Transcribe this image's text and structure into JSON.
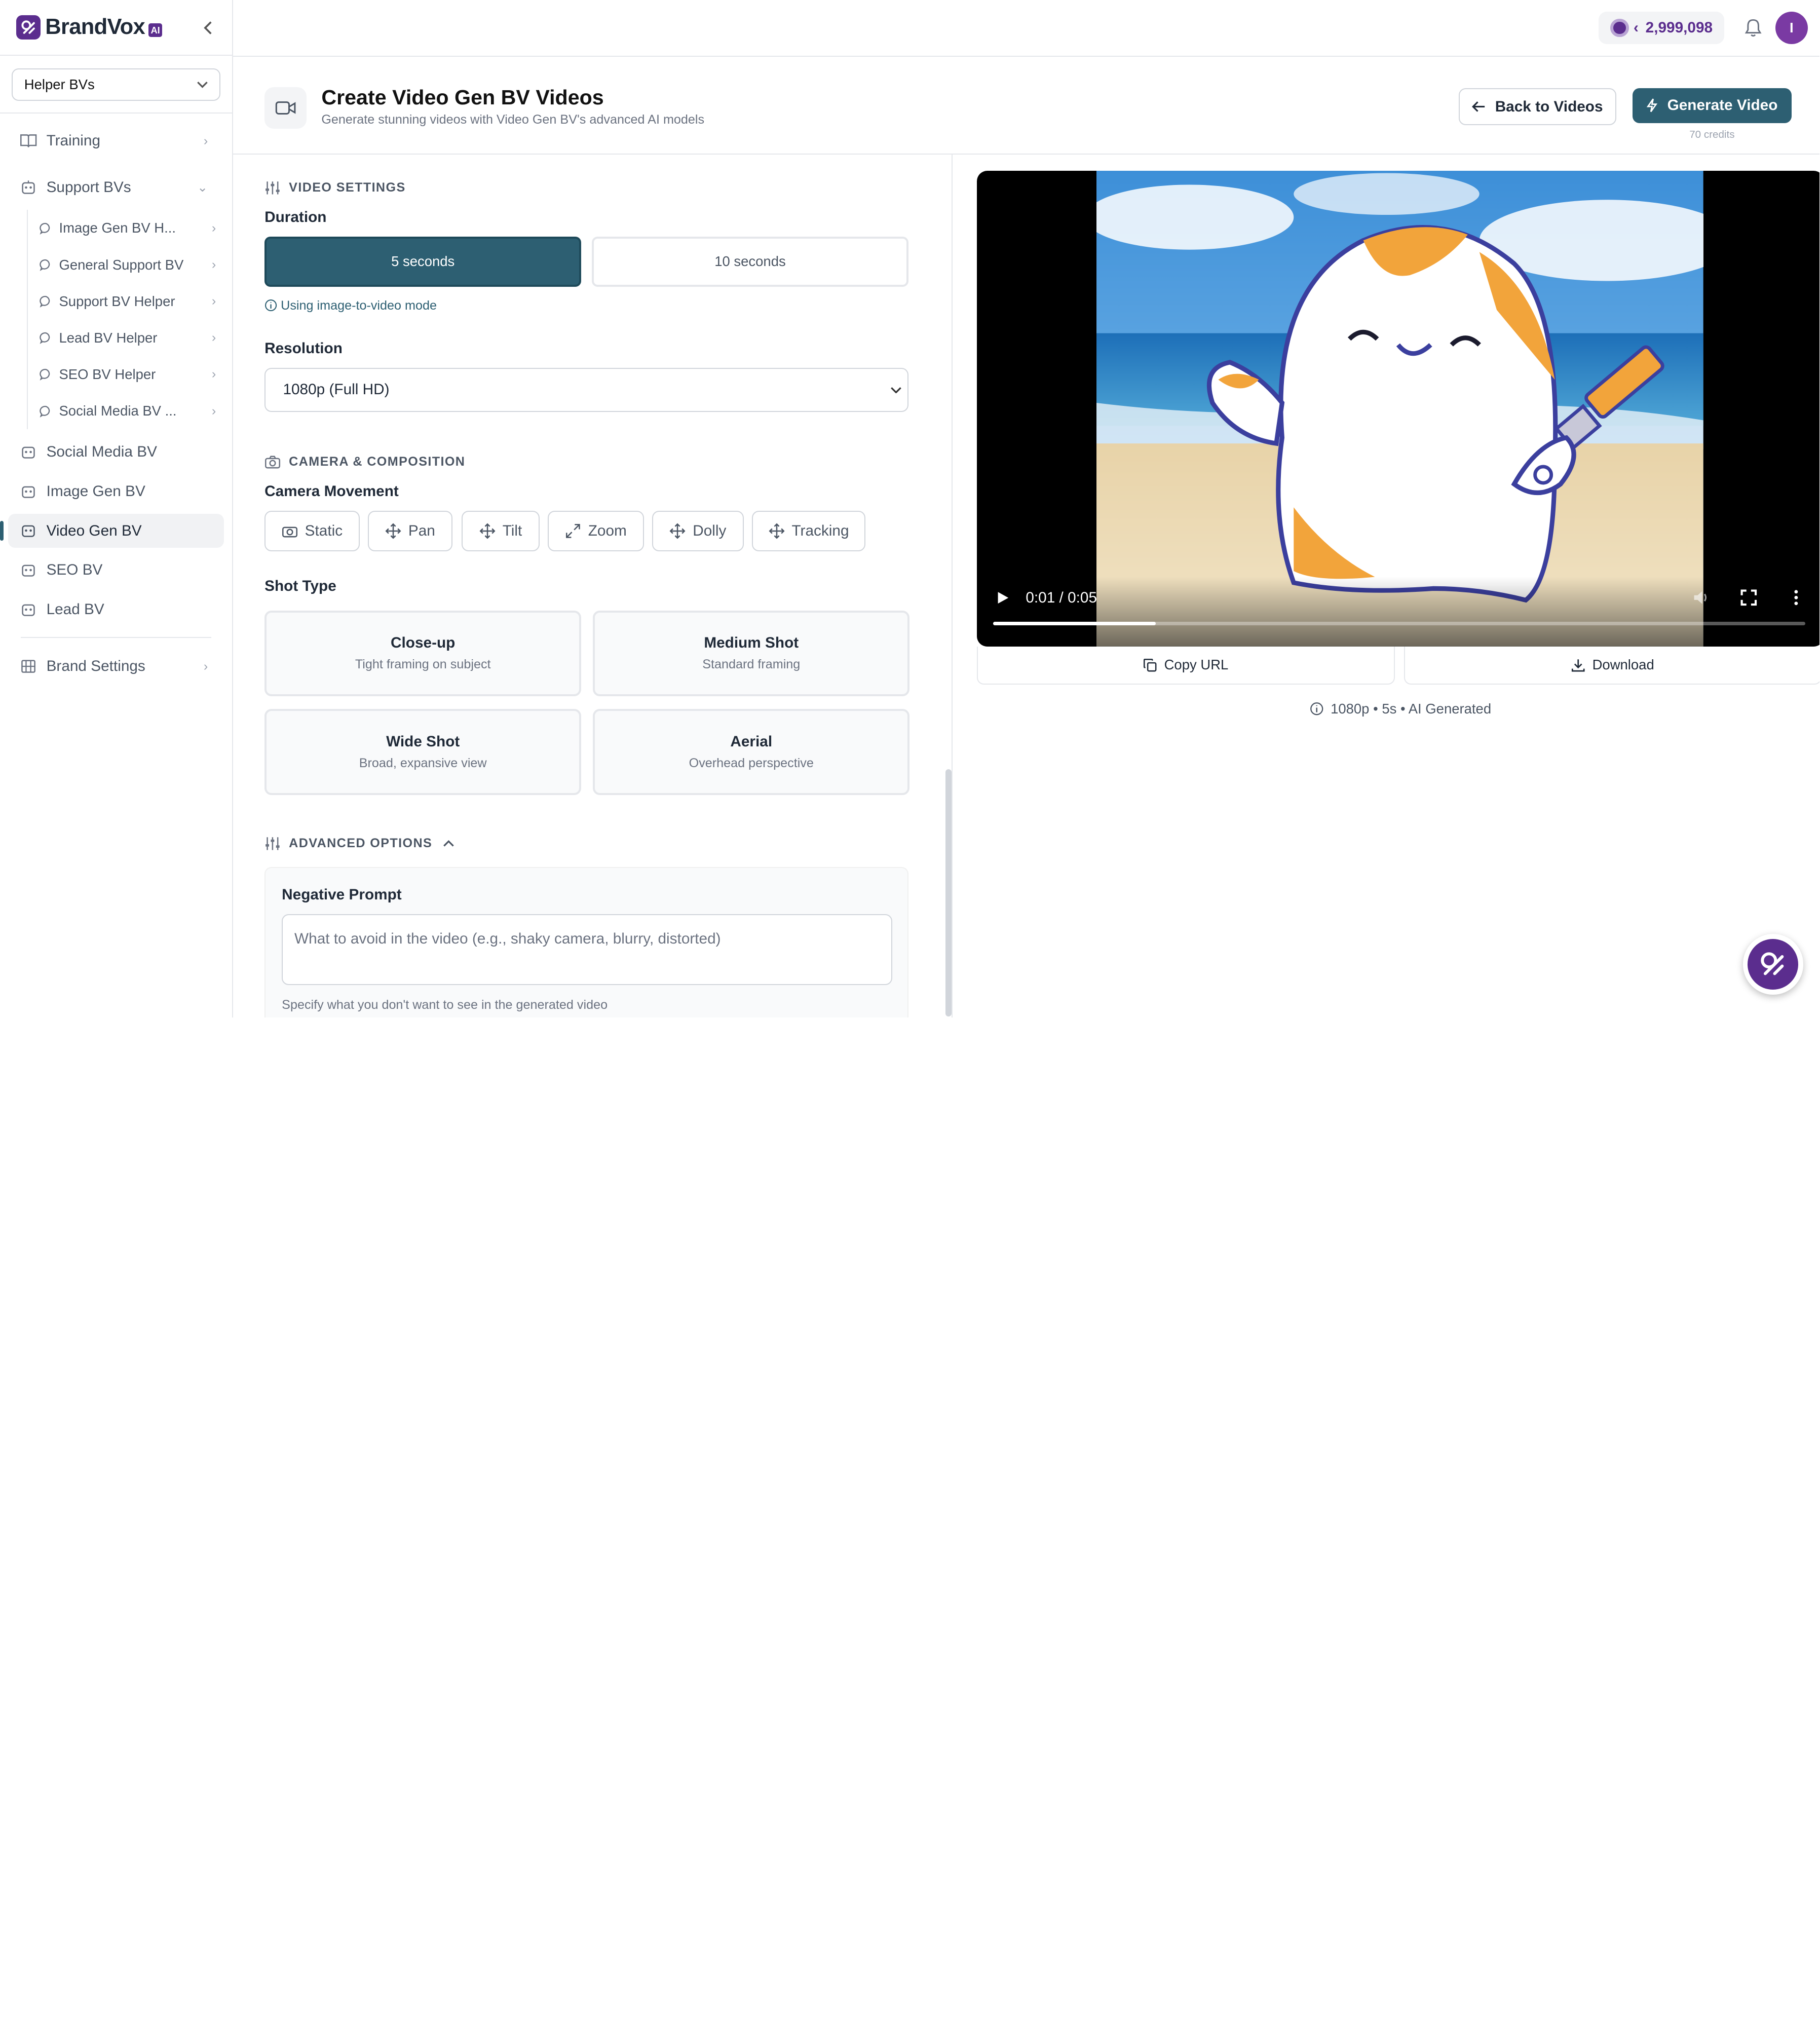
{
  "brand": {
    "name": "BrandVox",
    "badge": "AI",
    "accent": "#5b2d8e",
    "primary": "#2d5f72"
  },
  "sidebar": {
    "selector": "Helper BVs",
    "items": [
      {
        "label": "Training",
        "icon": "book-icon"
      },
      {
        "label": "Support BVs",
        "icon": "robot-icon"
      },
      {
        "label": "Social Media BV",
        "icon": "robot-icon"
      },
      {
        "label": "Image Gen BV",
        "icon": "robot-icon"
      },
      {
        "label": "Video Gen BV",
        "icon": "robot-icon",
        "active": true
      },
      {
        "label": "SEO BV",
        "icon": "robot-icon"
      },
      {
        "label": "Lead BV",
        "icon": "robot-icon"
      },
      {
        "label": "Brand Settings",
        "icon": "building-icon"
      }
    ],
    "sub_items": [
      {
        "label": "Image Gen BV H..."
      },
      {
        "label": "General Support BV"
      },
      {
        "label": "Support BV Helper"
      },
      {
        "label": "Lead BV Helper"
      },
      {
        "label": "SEO BV Helper"
      },
      {
        "label": "Social Media BV ..."
      }
    ]
  },
  "topbar": {
    "credits": "2,999,098",
    "avatar_initial": "I"
  },
  "header": {
    "title": "Create Video Gen BV Videos",
    "subtitle": "Generate stunning videos with Video Gen BV's advanced AI models",
    "back_label": "Back to Videos",
    "generate_label": "Generate Video",
    "generate_credits": "70 credits"
  },
  "settings": {
    "video_settings_heading": "VIDEO SETTINGS",
    "duration_label": "Duration",
    "duration_options": [
      "5 seconds",
      "10 seconds"
    ],
    "duration_selected": "5 seconds",
    "mode_hint": "Using image-to-video mode",
    "resolution_label": "Resolution",
    "resolution_value": "1080p (Full HD)",
    "camera_heading": "CAMERA & COMPOSITION",
    "camera_movement_label": "Camera Movement",
    "camera_movements": [
      "Static",
      "Pan",
      "Tilt",
      "Zoom",
      "Dolly",
      "Tracking"
    ],
    "shot_type_label": "Shot Type",
    "shot_types": [
      {
        "title": "Close-up",
        "desc": "Tight framing on subject"
      },
      {
        "title": "Medium Shot",
        "desc": "Standard framing"
      },
      {
        "title": "Wide Shot",
        "desc": "Broad, expansive view"
      },
      {
        "title": "Aerial",
        "desc": "Overhead perspective"
      }
    ],
    "advanced_heading": "ADVANCED OPTIONS",
    "negative_prompt_label": "Negative Prompt",
    "negative_prompt_placeholder": "What to avoid in the video (e.g., shaky camera, blurry, distorted)",
    "negative_prompt_help": "Specify what you don't want to see in the generated video"
  },
  "preview": {
    "time": "0:01 / 0:05",
    "progress": 0.2,
    "copy_label": "Copy URL",
    "download_label": "Download",
    "meta": "1080p • 5s • AI Generated"
  }
}
